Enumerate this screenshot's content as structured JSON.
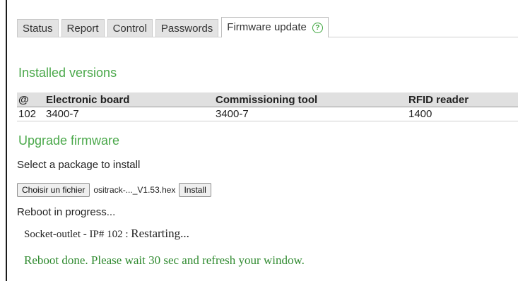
{
  "tabs": [
    {
      "label": "Status"
    },
    {
      "label": "Report"
    },
    {
      "label": "Control"
    },
    {
      "label": "Passwords"
    },
    {
      "label": "Firmware update",
      "active": true
    }
  ],
  "help_icon_glyph": "?",
  "installed": {
    "heading": "Installed versions",
    "columns": [
      "@",
      "Electronic board",
      "Commissioning tool",
      "RFID reader"
    ],
    "rows": [
      [
        "102",
        "3400-7",
        "3400-7",
        "1400"
      ]
    ]
  },
  "upgrade": {
    "heading": "Upgrade firmware",
    "prompt": "Select a package to install",
    "choose_label": "Choisir un fichier",
    "file_name": "ositrack-..._V1.53.hex",
    "install_label": "Install"
  },
  "status": {
    "reboot_text": "Reboot in progress...",
    "device_text": "Socket-outlet - IP# 102 : ",
    "device_state": "Restarting...",
    "done_text": "Reboot done. Please wait 30 sec and refresh your window."
  },
  "colors": {
    "accent_green": "#4aa84a",
    "done_green": "#2f8a2f"
  }
}
